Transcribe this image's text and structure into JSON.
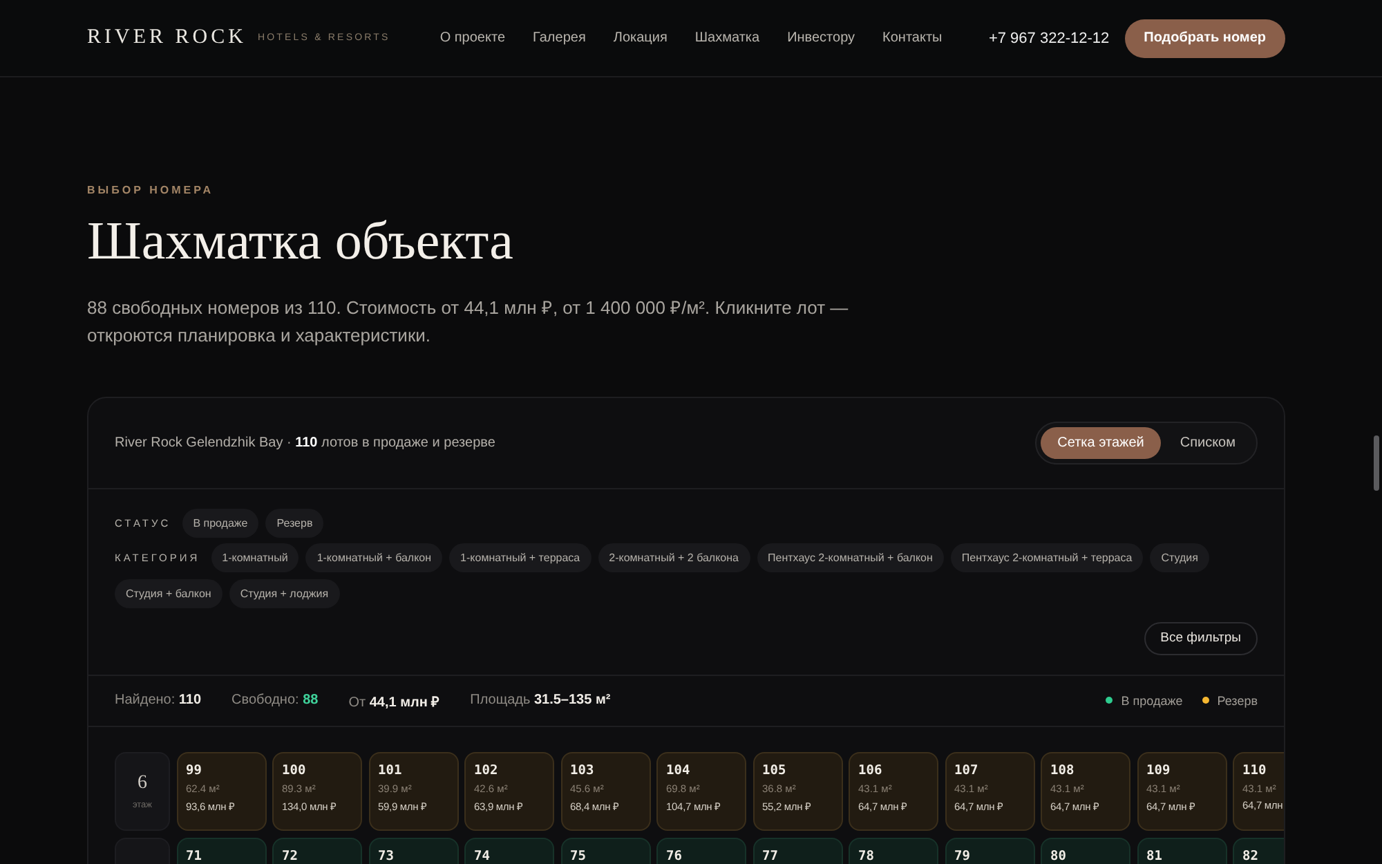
{
  "header": {
    "logo": "RIVER ROCK",
    "logo_tagline": "HOTELS & RESORTS",
    "nav": [
      "О проекте",
      "Галерея",
      "Локация",
      "Шахматка",
      "Инвестору",
      "Контакты"
    ],
    "phone": "+7 967 322-12-12",
    "cta": "Подобрать номер"
  },
  "intro": {
    "eyebrow": "ВЫБОР НОМЕРА",
    "title": "Шахматка объекта",
    "lead": "88 свободных номеров из 110. Стоимость от 44,1 млн ₽, от 1 400 000 ₽/м². Кликните лот — откроются планировка и характеристики."
  },
  "panel": {
    "summary": "River Rock Gelendzhik Bay · **110** лотов в продаже и резерве",
    "views": [
      {
        "label": "Сетка этажей",
        "selected": true
      },
      {
        "label": "Списком",
        "selected": false
      }
    ],
    "filters": [
      {
        "label": "СТАТУС",
        "chips": [
          "В продаже",
          "Резерв"
        ]
      },
      {
        "label": "КАТЕГОРИЯ",
        "chips": [
          "1-комнатный",
          "1-комнатный + балкон",
          "1-комнатный + терраса",
          "2-комнатный + 2 балкона",
          "Пентхаус 2-комнатный + балкон",
          "Пентхаус 2-комнатный + терраса",
          "Студия",
          "Студия + балкон",
          "Студия + лоджия"
        ]
      }
    ],
    "all_filters": "Все фильтры",
    "stats": [
      {
        "label": "Найдено:",
        "value": "110",
        "highlight": false
      },
      {
        "label": "Свободно:",
        "value": "88",
        "highlight": true
      },
      {
        "label": "От",
        "value": "44,1 млн ₽",
        "highlight": false
      },
      {
        "label": "Площадь",
        "value": "31.5–135 м²",
        "highlight": false
      }
    ],
    "legend": [
      {
        "label": "В продаже",
        "color": "#2ecc8f"
      },
      {
        "label": "Резерв",
        "color": "#f5b731"
      }
    ],
    "floors": [
      {
        "floor": "6",
        "floor_label": "этаж",
        "lots": [
          {
            "number": "99",
            "area": "62.4 м²",
            "price": "93,6 млн ₽",
            "reserved": true
          },
          {
            "number": "100",
            "area": "89.3 м²",
            "price": "134,0 млн ₽",
            "reserved": true
          },
          {
            "number": "101",
            "area": "39.9 м²",
            "price": "59,9 млн ₽",
            "reserved": true
          },
          {
            "number": "102",
            "area": "42.6 м²",
            "price": "63,9 млн ₽",
            "reserved": true
          },
          {
            "number": "103",
            "area": "45.6 м²",
            "price": "68,4 млн ₽",
            "reserved": true
          },
          {
            "number": "104",
            "area": "69.8 м²",
            "price": "104,7 млн ₽",
            "reserved": true
          },
          {
            "number": "105",
            "area": "36.8 м²",
            "price": "55,2 млн ₽",
            "reserved": true
          },
          {
            "number": "106",
            "area": "43.1 м²",
            "price": "64,7 млн ₽",
            "reserved": true
          },
          {
            "number": "107",
            "area": "43.1 м²",
            "price": "64,7 млн ₽",
            "reserved": true
          },
          {
            "number": "108",
            "area": "43.1 м²",
            "price": "64,7 млн ₽",
            "reserved": true
          },
          {
            "number": "109",
            "area": "43.1 м²",
            "price": "64,7 млн ₽",
            "reserved": true
          },
          {
            "number": "110",
            "area": "43.1 м²",
            "price": "64,7 млн",
            "reserved": true
          }
        ]
      },
      {
        "lots": [
          {
            "number": "71",
            "reserved": false
          },
          {
            "number": "72",
            "reserved": false
          },
          {
            "number": "73",
            "reserved": false
          },
          {
            "number": "74",
            "reserved": false
          },
          {
            "number": "75",
            "reserved": false
          },
          {
            "number": "76",
            "reserved": false
          },
          {
            "number": "77",
            "reserved": false
          },
          {
            "number": "78",
            "reserved": false
          },
          {
            "number": "79",
            "reserved": false
          },
          {
            "number": "80",
            "reserved": false
          },
          {
            "number": "81",
            "reserved": false
          },
          {
            "number": "82",
            "reserved": false
          }
        ]
      }
    ]
  }
}
